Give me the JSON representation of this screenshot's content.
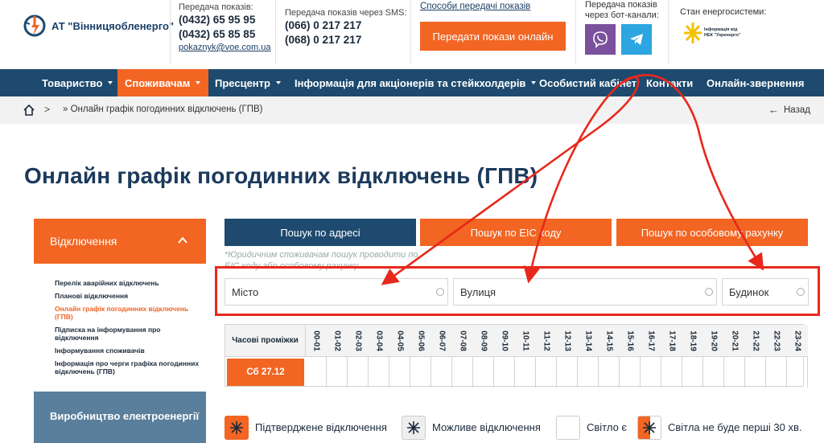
{
  "header": {
    "company_name": "АТ \"Вінницяобленерго\"",
    "phone_label": "Передача показів:",
    "phone_1": "(0432) 65 95 95",
    "phone_2": "(0432) 65 85 85",
    "email": "pokaznyk@voe.com.ua",
    "sms_label": "Передача показів через SMS:",
    "sms_1": "(066) 0 217 217",
    "sms_2": "(068) 0 217 217",
    "methods_link": "Способи передачі показів",
    "send_online_button": "Передати покази онлайн",
    "bot_label_1": "Передача показів",
    "bot_label_2": "через бот-канали:",
    "grid_status_label": "Стан енергосистеми:",
    "grid_logo_line_1": "Інформація від",
    "grid_logo_line_2": "НЕК \"Укренерго\"",
    "colors": {
      "orange": "#f26522",
      "navy": "#1d4a6e",
      "viber": "#7b519d",
      "telegram": "#2ca5e0"
    }
  },
  "nav": {
    "items": [
      {
        "label": "Товариство",
        "caret": true
      },
      {
        "label": "Споживачам",
        "caret": true,
        "active": true
      },
      {
        "label": "Пресцентр",
        "caret": true
      },
      {
        "label": "Інформація для акціонерів та стейкхолдерів",
        "caret": true
      },
      {
        "label": "Особистий кабінет",
        "caret": false
      },
      {
        "label": "Контакти",
        "caret": false
      },
      {
        "label": "Онлайн-звернення",
        "caret": false
      }
    ]
  },
  "breadcrumb": {
    "separator": ">",
    "current": "» Онлайн графік погодинних відключень (ГПВ)",
    "back_label": "Назад"
  },
  "page_title": "Онлайн графік погодинних відключень (ГПВ)",
  "sidebar": {
    "section_title": "Відключення",
    "links": [
      {
        "label": "Перелік аварійних відключень"
      },
      {
        "label": "Планові відключення"
      },
      {
        "label": "Онлайн графік погодинних відключень (ГПВ)",
        "active": true
      },
      {
        "label": "Підписка на інформування про відключення"
      },
      {
        "label": "Інформування споживачів"
      },
      {
        "label": "Інформація про черги графіка погодинних відключень (ГПВ)"
      }
    ],
    "next_section": "Виробництво електроенергії"
  },
  "search": {
    "tabs": [
      "Пошук по адресі",
      "Пошук по ЕІС коду",
      "Пошук по особовому рахунку"
    ],
    "note": "*Юридичним споживачам пошук проводити по ЕІС коду або особовому рахунку",
    "city_placeholder": "Місто",
    "street_placeholder": "Вулиця",
    "house_placeholder": "Будинок"
  },
  "schedule": {
    "header_label": "Часові проміжки",
    "day_label": "Сб 27.12",
    "hours": [
      "00-01",
      "01-02",
      "02-03",
      "03-04",
      "04-05",
      "05-06",
      "06-07",
      "07-08",
      "08-09",
      "09-10",
      "10-11",
      "11-12",
      "12-13",
      "13-14",
      "14-15",
      "15-16",
      "16-17",
      "17-18",
      "18-19",
      "19-20",
      "20-21",
      "21-22",
      "22-23",
      "23-24"
    ]
  },
  "legend": [
    {
      "label": "Підтверджене відключення",
      "icon": "confirmed-outage-icon"
    },
    {
      "label": "Можливе відключення",
      "icon": "possible-outage-icon"
    },
    {
      "label": "Світло є",
      "icon": "power-on-icon"
    },
    {
      "label": "Світла не буде перші 30 хв.",
      "icon": "half-hour-outage-icon"
    }
  ]
}
